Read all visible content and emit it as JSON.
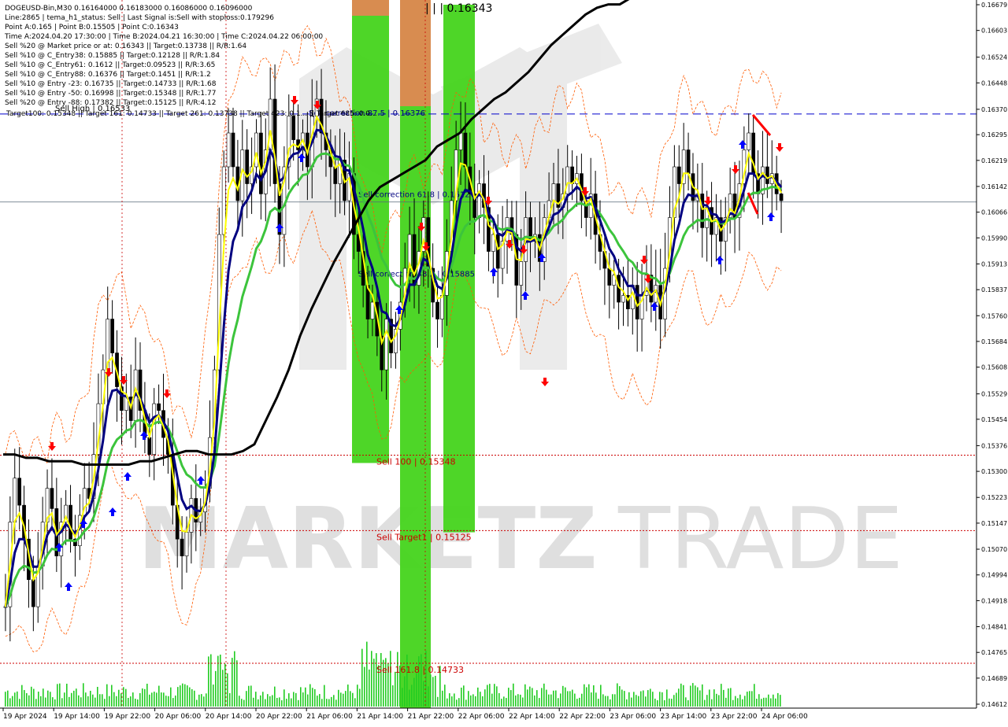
{
  "info_panel": {
    "lines": [
      "DOGEUSD-Bin,M30  0.16164000 0.16183000 0.16086000 0.16096000",
      "Line:2865 | tema_h1_status: Sell | Last Signal is:Sell with stoploss:0.179296",
      "Point A:0.165 | Point B:0.15505 | Point C:0.16343",
      "Time A:2024.04.20 17:30:00 | Time B:2024.04.21 16:30:00 | Time C:2024.04.22 06:00:00",
      "Sell %20 @ Market price or at: 0.16343 || Target:0.13738 || R/R:1.64",
      "Sell %10 @ C_Entry38: 0.15885 || Target:0.12128 || R/R:1.84",
      "Sell %10 @ C_Entry61: 0.1612 || Target:0.09523 || R/R:3.65",
      "Sell %10 @ C_Entry88: 0.16376 || Target:0.1451 || R/R:1.2",
      "Sell %10 @ Entry -23: 0.16735 || Target:0.14733 || R/R:1.68",
      "Sell %10 @ Entry -50: 0.16998 || Target:0.15348 || R/R:1.77",
      "Sell %20 @ Entry -88: 0.17382 || Target:0.15125 || R/R:4.12"
    ],
    "targets_line": "Target100: 0.15348 || Target 161: 0.14733 || Target 261: 0.13738 || Target 423: 0.1... || Target 685: 0.0...",
    "top_price_label": "| | | 0.16343"
  },
  "watermark": {
    "text_bold": "MARKETZ",
    "text_light": "TRADE"
  },
  "colors": {
    "background": "#ffffff",
    "candle": "#000000",
    "ma_black": "#000000",
    "ma_green": "#3cc43c",
    "ma_navy": "#000080",
    "ma_yellow": "#ffff00",
    "band_red": "#ff5a00",
    "level_blue": "#0000cc",
    "level_red": "#cc0000",
    "zone_green": "#44d41c",
    "zone_orange": "#d88c50",
    "arrow_up": "#0000ff",
    "arrow_down": "#ff0000",
    "volume": "#22cc22",
    "tag_blue_bg": "#1e4fc8",
    "tag_red_bg": "#c81e1e",
    "tag_black_bg": "#000000"
  },
  "chart_data": {
    "type": "candlestick",
    "symbol": "DOGEUSD-Bin",
    "timeframe": "M30",
    "ohlc_last": {
      "open": 0.16164,
      "high": 0.16183,
      "low": 0.16086,
      "close": 0.16096
    },
    "ylim": [
      0.14612,
      0.16679
    ],
    "y_ticks": [
      "0.16679",
      "0.16603",
      "0.16524",
      "0.16448",
      "0.16370",
      "0.16295",
      "0.16219",
      "0.16142",
      "0.16066",
      "0.15990",
      "0.15913",
      "0.15837",
      "0.15760",
      "0.15684",
      "0.15608",
      "0.15529",
      "0.15454",
      "0.15376",
      "0.15300",
      "0.15223",
      "0.15147",
      "0.15070",
      "0.14994",
      "0.14918",
      "0.14841",
      "0.14765",
      "0.14689",
      "0.14612"
    ],
    "x_ticks": [
      "19 Apr 2024",
      "19 Apr 14:00",
      "19 Apr 22:00",
      "20 Apr 06:00",
      "20 Apr 14:00",
      "20 Apr 22:00",
      "21 Apr 06:00",
      "21 Apr 14:00",
      "21 Apr 22:00",
      "22 Apr 06:00",
      "22 Apr 14:00",
      "22 Apr 22:00",
      "23 Apr 06:00",
      "23 Apr 14:00",
      "23 Apr 22:00",
      "24 Apr 06:00"
    ],
    "levels": [
      {
        "label": "Sell 100 | 0.15348",
        "price": 0.15348,
        "tag": "0.15348",
        "color": "red"
      },
      {
        "label": "Sell Target1 | 0.15125",
        "price": 0.15125,
        "tag": "0.15125",
        "color": "red"
      },
      {
        "label": "Sell 161.8 | 0.14733",
        "price": 0.14733,
        "tag": "0.14733",
        "color": "red"
      },
      {
        "label": "Sell correction 87.5 | 0.16376",
        "price": 0.16356,
        "tag": "0.16356",
        "color": "blue"
      },
      {
        "label": "Sell correction 61.8 | 0.1612",
        "price": 0.1612,
        "tag": "",
        "color": "none"
      },
      {
        "label": "Sell correction 38.2 | 0.15885",
        "price": 0.15885,
        "tag": "",
        "color": "none"
      }
    ],
    "current_price": 0.16096,
    "top_label_price": "0.16343",
    "high_label": "Sell High | 0.16533",
    "closes": [
      0.149,
      0.1515,
      0.1528,
      0.152,
      0.151,
      0.1498,
      0.149,
      0.1502,
      0.1515,
      0.1525,
      0.1519,
      0.1505,
      0.1515,
      0.152,
      0.151,
      0.1508,
      0.1517,
      0.1525,
      0.1522,
      0.1535,
      0.155,
      0.156,
      0.1575,
      0.1565,
      0.1555,
      0.1548,
      0.1552,
      0.1545,
      0.156,
      0.1548,
      0.154,
      0.1535,
      0.155,
      0.1548,
      0.154,
      0.1535,
      0.152,
      0.151,
      0.1505,
      0.1512,
      0.1522,
      0.1515,
      0.1518,
      0.1525,
      0.154,
      0.156,
      0.16,
      0.162,
      0.163,
      0.162,
      0.161,
      0.1625,
      0.1615,
      0.162,
      0.163,
      0.1612,
      0.1625,
      0.164,
      0.1615,
      0.16,
      0.162,
      0.1635,
      0.1628,
      0.1625,
      0.163,
      0.162,
      0.1635,
      0.164,
      0.163,
      0.1625,
      0.162,
      0.1615,
      0.1622,
      0.161,
      0.1618,
      0.16,
      0.1595,
      0.1585,
      0.1575,
      0.158,
      0.157,
      0.156,
      0.1575,
      0.1565,
      0.1572,
      0.158,
      0.159,
      0.16,
      0.1585,
      0.1595,
      0.1605,
      0.159,
      0.158,
      0.1575,
      0.1582,
      0.1595,
      0.161,
      0.1625,
      0.163,
      0.162,
      0.1612,
      0.1605,
      0.1615,
      0.1608,
      0.1595,
      0.16,
      0.159,
      0.1598,
      0.1605,
      0.16,
      0.1585,
      0.1592,
      0.1605,
      0.1598,
      0.16,
      0.1592,
      0.1605,
      0.161,
      0.1615,
      0.1608,
      0.1612,
      0.162,
      0.1615,
      0.1618,
      0.161,
      0.1605,
      0.1612,
      0.16,
      0.1595,
      0.159,
      0.1585,
      0.1588,
      0.158,
      0.1582,
      0.1578,
      0.1585,
      0.1575,
      0.1582,
      0.1588,
      0.158,
      0.1585,
      0.1575,
      0.159,
      0.1605,
      0.162,
      0.1615,
      0.1625,
      0.1618,
      0.161,
      0.1612,
      0.1602,
      0.1608,
      0.16,
      0.1605,
      0.1598,
      0.1605,
      0.1612,
      0.1605,
      0.1615,
      0.1625,
      0.163,
      0.1618,
      0.1612,
      0.162,
      0.1615,
      0.1618,
      0.1612,
      0.161
    ],
    "ma_black": [
      0.1535,
      0.1535,
      0.1534,
      0.1534,
      0.1533,
      0.1533,
      0.1533,
      0.1532,
      0.1532,
      0.1532,
      0.1532,
      0.1532,
      0.1533,
      0.1533,
      0.1534,
      0.1535,
      0.1536,
      0.1536,
      0.1535,
      0.1535,
      0.1535,
      0.1536,
      0.1538,
      0.1545,
      0.1552,
      0.156,
      0.157,
      0.1578,
      0.1585,
      0.1592,
      0.1598,
      0.1604,
      0.161,
      0.1614,
      0.1616,
      0.1618,
      0.162,
      0.1622,
      0.1626,
      0.1628,
      0.163,
      0.1634,
      0.1637,
      0.164,
      0.1642,
      0.1645,
      0.1648,
      0.1652,
      0.1656,
      0.1659,
      0.1662,
      0.1665,
      0.1667,
      0.1668,
      0.1668,
      0.167,
      0.1672,
      0.1674,
      0.1676,
      0.1678,
      0.168,
      0.1682,
      0.1684,
      0.1685,
      0.1686,
      0.1688,
      0.169,
      0.1692,
      0.1694
    ],
    "x_labels_visible": true,
    "grid": false,
    "legend": "none"
  }
}
